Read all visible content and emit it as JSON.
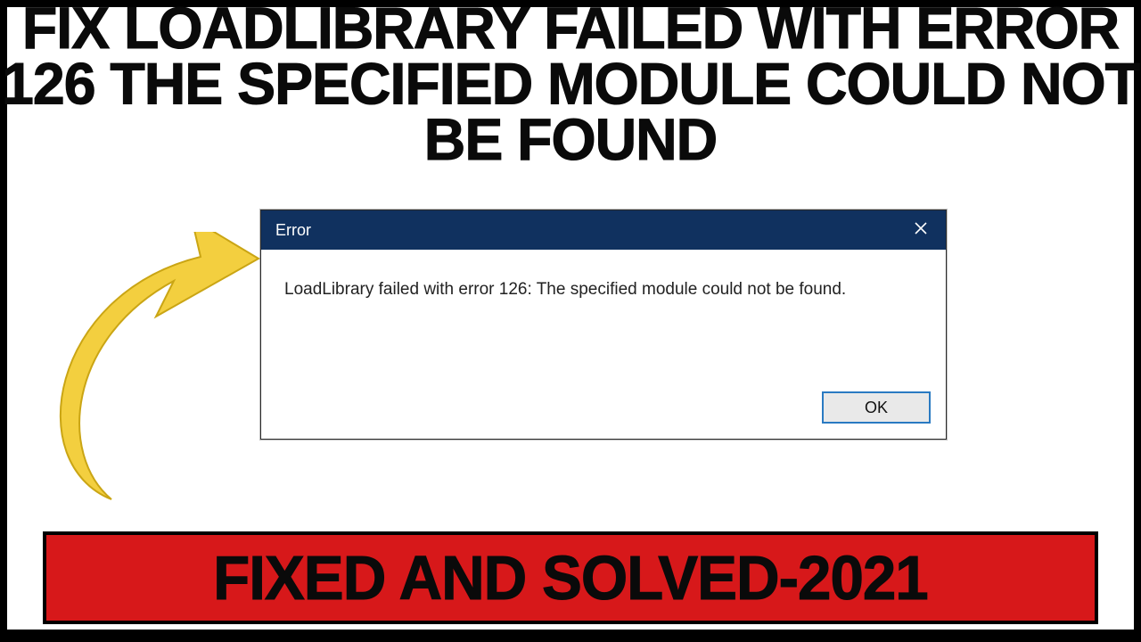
{
  "thumbnail": {
    "headline": "FIX LOADLIBRARY FAILED WITH ERROR 126 THE SPECIFIED MODULE COULD NOT BE FOUND",
    "footer": "FIXED AND SOLVED-2021"
  },
  "dialog": {
    "title": "Error",
    "message": "LoadLibrary failed with error 126: The specified module could not be found.",
    "ok_label": "OK"
  },
  "icons": {
    "close": "close-icon",
    "arrow": "curved-arrow-icon"
  },
  "colors": {
    "titlebar": "#10315f",
    "band": "#d7181a",
    "arrow": "#f3cf3f"
  }
}
